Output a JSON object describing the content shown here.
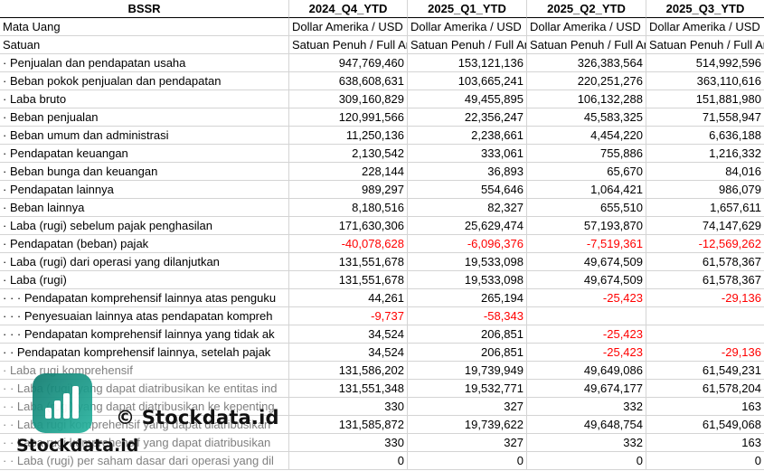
{
  "header": {
    "label": "BSSR",
    "periods": [
      "2024_Q4_YTD",
      "2025_Q1_YTD",
      "2025_Q2_YTD",
      "2025_Q3_YTD"
    ]
  },
  "rows": [
    {
      "label": "Mata Uang",
      "values": [
        "Dollar Amerika / USD",
        "Dollar Amerika / USD",
        "Dollar Amerika / USD",
        "Dollar Amerika / USD"
      ],
      "text": true
    },
    {
      "label": "Satuan",
      "values": [
        "Satuan Penuh / Full Amount",
        "Satuan Penuh / Full Amount",
        "Satuan Penuh / Full Amount",
        "Satuan Penuh / Full Amount"
      ],
      "text": true
    },
    {
      "label": "· Penjualan dan pendapatan usaha",
      "values": [
        "947,769,460",
        "153,121,136",
        "326,383,564",
        "514,992,596"
      ]
    },
    {
      "label": "· Beban pokok penjualan dan pendapatan",
      "values": [
        "638,608,631",
        "103,665,241",
        "220,251,276",
        "363,110,616"
      ]
    },
    {
      "label": "· Laba bruto",
      "values": [
        "309,160,829",
        "49,455,895",
        "106,132,288",
        "151,881,980"
      ]
    },
    {
      "label": "· Beban penjualan",
      "values": [
        "120,991,566",
        "22,356,247",
        "45,583,325",
        "71,558,947"
      ]
    },
    {
      "label": "· Beban umum dan administrasi",
      "values": [
        "11,250,136",
        "2,238,661",
        "4,454,220",
        "6,636,188"
      ]
    },
    {
      "label": "· Pendapatan keuangan",
      "values": [
        "2,130,542",
        "333,061",
        "755,886",
        "1,216,332"
      ]
    },
    {
      "label": "· Beban bunga dan keuangan",
      "values": [
        "228,144",
        "36,893",
        "65,670",
        "84,016"
      ]
    },
    {
      "label": "· Pendapatan lainnya",
      "values": [
        "989,297",
        "554,646",
        "1,064,421",
        "986,079"
      ]
    },
    {
      "label": "· Beban lainnya",
      "values": [
        "8,180,516",
        "82,327",
        "655,510",
        "1,657,611"
      ]
    },
    {
      "label": "· Laba (rugi) sebelum pajak penghasilan",
      "values": [
        "171,630,306",
        "25,629,474",
        "57,193,870",
        "74,147,629"
      ]
    },
    {
      "label": "· Pendapatan (beban) pajak",
      "values": [
        "-40,078,628",
        "-6,096,376",
        "-7,519,361",
        "-12,569,262"
      ]
    },
    {
      "label": "· Laba (rugi) dari operasi yang dilanjutkan",
      "values": [
        "131,551,678",
        "19,533,098",
        "49,674,509",
        "61,578,367"
      ]
    },
    {
      "label": "· Laba (rugi)",
      "values": [
        "131,551,678",
        "19,533,098",
        "49,674,509",
        "61,578,367"
      ]
    },
    {
      "label": "· · · Pendapatan komprehensif lainnya atas penguku",
      "values": [
        "44,261",
        "265,194",
        "-25,423",
        "-29,136"
      ]
    },
    {
      "label": "· · · Penyesuaian lainnya atas pendapatan kompreh",
      "values": [
        "-9,737",
        "-58,343",
        "",
        ""
      ]
    },
    {
      "label": "· · · Pendapatan komprehensif lainnya yang tidak ak",
      "values": [
        "34,524",
        "206,851",
        "-25,423",
        ""
      ]
    },
    {
      "label": "· · Pendapatan komprehensif lainnya, setelah pajak",
      "values": [
        "34,524",
        "206,851",
        "-25,423",
        "-29,136"
      ]
    },
    {
      "label": "· Laba rugi komprehensif",
      "values": [
        "131,586,202",
        "19,739,949",
        "49,649,086",
        "61,549,231"
      ],
      "muted": true
    },
    {
      "label": "· · Laba (rugi) yang dapat diatribusikan ke entitas ind",
      "values": [
        "131,551,348",
        "19,532,771",
        "49,674,177",
        "61,578,204"
      ],
      "muted": true
    },
    {
      "label": "· · Laba (rugi) yang dapat diatribusikan ke kepenting",
      "values": [
        "330",
        "327",
        "332",
        "163"
      ],
      "muted": true
    },
    {
      "label": "· · Laba rugi komprehensif yang dapat diatribusikan",
      "values": [
        "131,585,872",
        "19,739,622",
        "49,648,754",
        "61,549,068"
      ],
      "muted": true
    },
    {
      "label": "· · Laba rugi komprehensif yang dapat diatribusikan",
      "values": [
        "330",
        "327",
        "332",
        "163"
      ],
      "muted": true
    },
    {
      "label": "· · Laba (rugi) per saham dasar dari operasi yang dil",
      "values": [
        "0",
        "0",
        "0",
        "0"
      ],
      "muted": true
    }
  ],
  "watermark": {
    "text_main": "© Stockdata.id",
    "text_logo": "Stockdata.id",
    "logo_icon": "bar-chart-icon",
    "logo_color": "#1a9a88"
  }
}
